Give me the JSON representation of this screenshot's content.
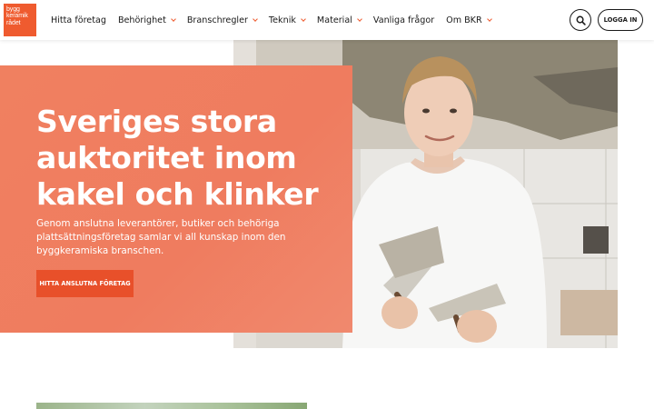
{
  "logo": {
    "lines": [
      "bygg",
      "keramik",
      "rådet"
    ]
  },
  "nav": {
    "items": [
      {
        "label": "Hitta företag",
        "has_dropdown": false
      },
      {
        "label": "Behörighet",
        "has_dropdown": true
      },
      {
        "label": "Branschregler",
        "has_dropdown": true
      },
      {
        "label": "Teknik",
        "has_dropdown": true
      },
      {
        "label": "Material",
        "has_dropdown": true
      },
      {
        "label": "Vanliga frågor",
        "has_dropdown": false
      },
      {
        "label": "Om BKR",
        "has_dropdown": true
      }
    ],
    "search_icon": "search-icon",
    "login_label": "LOGGA IN"
  },
  "hero": {
    "title": "Sveriges stora auktoritet inom kakel och klinker",
    "subtitle": "Genom anslutna leverantörer, butiker och behöriga plattsättningsföretag samlar vi all kunskap inom den byggkeramiska branschen.",
    "cta_label": "HITTA ANSLUTNA FÖRETAG"
  },
  "colors": {
    "brand": "#ef5b2f",
    "hero_card": "#ef7c5f",
    "cta": "#e8502a",
    "text": "#1a1a1a"
  }
}
